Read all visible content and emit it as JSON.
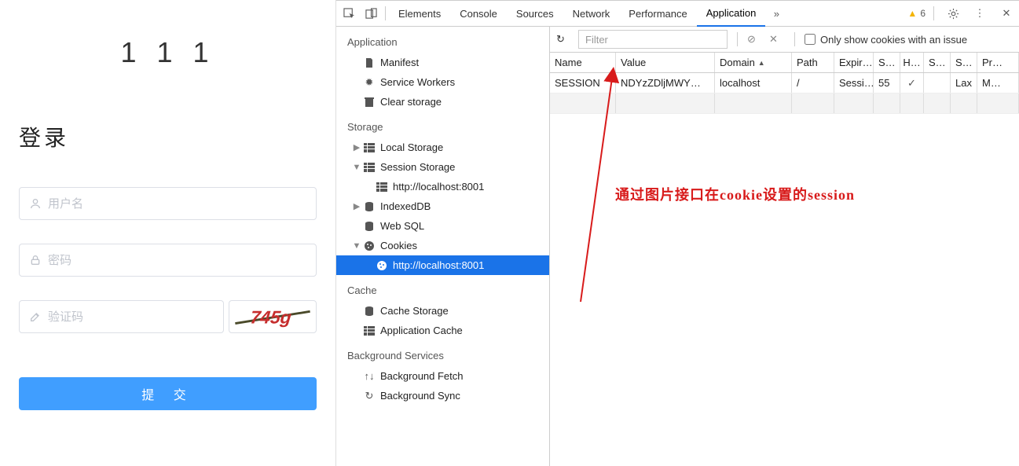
{
  "page": {
    "title": "1 1 1",
    "form_title": "登录",
    "placeholders": {
      "username": "用户名",
      "password": "密码",
      "captcha": "验证码"
    },
    "submit": "提 交",
    "captcha_text": "745g"
  },
  "devtools": {
    "tabs": [
      "Elements",
      "Console",
      "Sources",
      "Network",
      "Performance",
      "Application"
    ],
    "active_tab": "Application",
    "warnings": "6",
    "sidebar": {
      "application_title": "Application",
      "application_items": [
        "Manifest",
        "Service Workers",
        "Clear storage"
      ],
      "storage_title": "Storage",
      "local_storage": "Local Storage",
      "session_storage": "Session Storage",
      "session_storage_host": "http://localhost:8001",
      "indexeddb": "IndexedDB",
      "websql": "Web SQL",
      "cookies": "Cookies",
      "cookies_host": "http://localhost:8001",
      "cache_title": "Cache",
      "cache_items": [
        "Cache Storage",
        "Application Cache"
      ],
      "bg_title": "Background Services",
      "bg_items": [
        "Background Fetch",
        "Background Sync"
      ]
    },
    "filter": {
      "placeholder": "Filter",
      "only_issue": "Only show cookies with an issue"
    },
    "table": {
      "headers": {
        "name": "Name",
        "value": "Value",
        "domain": "Domain",
        "path": "Path",
        "expires": "Expir…",
        "size": "S…",
        "http": "H…",
        "secure": "S…",
        "same": "S…",
        "priority": "Pr…"
      },
      "rows": [
        {
          "name": "SESSION",
          "value": "NDYzZDljMWY…",
          "domain": "localhost",
          "path": "/",
          "expires": "Sessi…",
          "size": "55",
          "http": "✓",
          "secure": "",
          "same": "Lax",
          "priority": "M…"
        }
      ]
    },
    "annotation": "通过图片接口在cookie设置的session"
  }
}
